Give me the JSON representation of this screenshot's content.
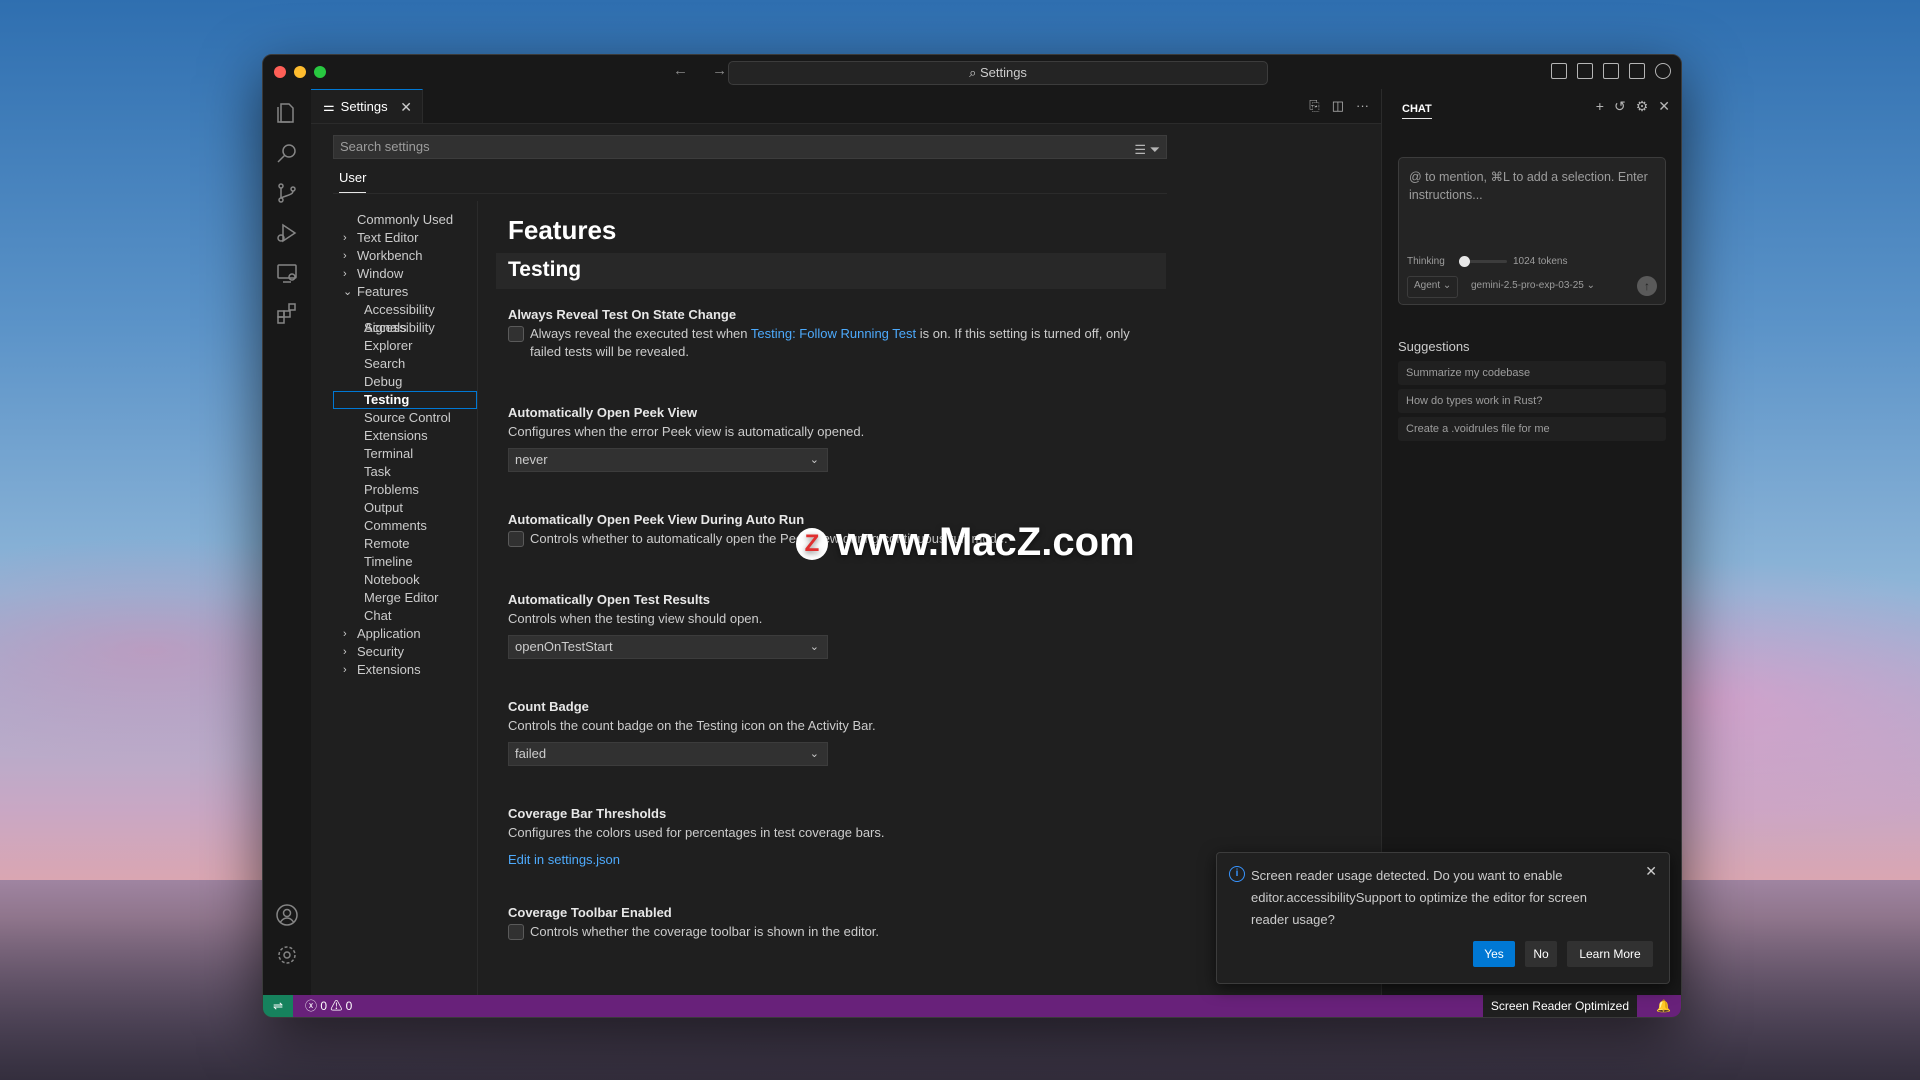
{
  "titlebar": {
    "command_center": "⌕ Settings",
    "nav_arrows": "← →"
  },
  "tab": {
    "label": "Settings",
    "icon_glyph": "⚌",
    "close": "✕"
  },
  "editor_actions": [
    "⎘",
    "◫",
    "···"
  ],
  "search": {
    "placeholder": "Search settings",
    "icons": "☰ ⏷"
  },
  "scope": {
    "user_tab": "User"
  },
  "toc": {
    "items": [
      {
        "label": "Commonly Used",
        "chevron": ""
      },
      {
        "label": "Text Editor",
        "chevron": "›"
      },
      {
        "label": "Workbench",
        "chevron": "›"
      },
      {
        "label": "Window",
        "chevron": "›"
      },
      {
        "label": "Features",
        "chevron": "⌄"
      },
      {
        "label": "Accessibility Signals",
        "chevron": ""
      },
      {
        "label": "Accessibility",
        "chevron": ""
      },
      {
        "label": "Explorer",
        "chevron": ""
      },
      {
        "label": "Search",
        "chevron": ""
      },
      {
        "label": "Debug",
        "chevron": ""
      },
      {
        "label": "Testing",
        "chevron": ""
      },
      {
        "label": "Source Control",
        "chevron": ""
      },
      {
        "label": "Extensions",
        "chevron": ""
      },
      {
        "label": "Terminal",
        "chevron": ""
      },
      {
        "label": "Task",
        "chevron": ""
      },
      {
        "label": "Problems",
        "chevron": ""
      },
      {
        "label": "Output",
        "chevron": ""
      },
      {
        "label": "Comments",
        "chevron": ""
      },
      {
        "label": "Remote",
        "chevron": ""
      },
      {
        "label": "Timeline",
        "chevron": ""
      },
      {
        "label": "Notebook",
        "chevron": ""
      },
      {
        "label": "Merge Editor",
        "chevron": ""
      },
      {
        "label": "Chat",
        "chevron": ""
      },
      {
        "label": "Application",
        "chevron": "›"
      },
      {
        "label": "Security",
        "chevron": "›"
      },
      {
        "label": "Extensions",
        "chevron": "›"
      }
    ]
  },
  "settings": {
    "section": "Features",
    "subsection": "Testing",
    "always_reveal": {
      "title": "Always Reveal Test On State Change",
      "desc_pre": "Always reveal the executed test when ",
      "desc_link": "Testing: Follow Running Test",
      "desc_post": " is on. If this setting is turned off, only failed tests will be revealed."
    },
    "open_peek": {
      "title": "Automatically Open Peek View",
      "desc": "Configures when the error Peek view is automatically opened.",
      "value": "never"
    },
    "open_peek_autorun": {
      "title": "Automatically Open Peek View During Auto Run",
      "desc": "Controls whether to automatically open the Peek view during continuous run mode."
    },
    "open_results": {
      "title": "Automatically Open Test Results",
      "desc": "Controls when the testing view should open.",
      "value": "openOnTestStart"
    },
    "count_badge": {
      "title": "Count Badge",
      "desc": "Controls the count badge on the Testing icon on the Activity Bar.",
      "value": "failed"
    },
    "coverage_thresholds": {
      "title": "Coverage Bar Thresholds",
      "desc": "Configures the colors used for percentages in test coverage bars.",
      "link": "Edit in settings.json"
    },
    "coverage_toolbar": {
      "title": "Coverage Toolbar Enabled",
      "desc": "Controls whether the coverage toolbar is shown in the editor."
    }
  },
  "chat": {
    "title": "CHAT",
    "actions": [
      "+",
      "↺",
      "⚙",
      "✕"
    ],
    "placeholder": "@ to mention, ⌘L to add a selection. Enter instructions...",
    "thinking_label": "Thinking",
    "tokens_label": "1024 tokens",
    "thinking_level": 0.0,
    "mode": "Agent ⌄",
    "model": "gemini-2.5-pro-exp-03-25 ⌄",
    "send_glyph": "↑",
    "suggestions_title": "Suggestions",
    "suggestions": [
      "Summarize my codebase",
      "How do types work in Rust?",
      "Create a .voidrules file for me"
    ]
  },
  "notification": {
    "icon_glyph": "i",
    "text": "Screen reader usage detected. Do you want to enable editor.accessibilitySupport to optimize the editor for screen reader usage?",
    "close": "✕",
    "yes": "Yes",
    "no": "No",
    "learn_more": "Learn More"
  },
  "statusbar": {
    "remote_glyph": "⇌",
    "problems": "ⓧ 0 ⚠ 0",
    "screen_reader": "Screen Reader Optimized",
    "bell": "🔔"
  },
  "watermark": {
    "logo": "Z",
    "text": "www.MacZ.com"
  },
  "colors": {
    "accent": "#0078d4",
    "link": "#4daafc",
    "statusbar": "#68217a",
    "remote": "#16825d"
  }
}
